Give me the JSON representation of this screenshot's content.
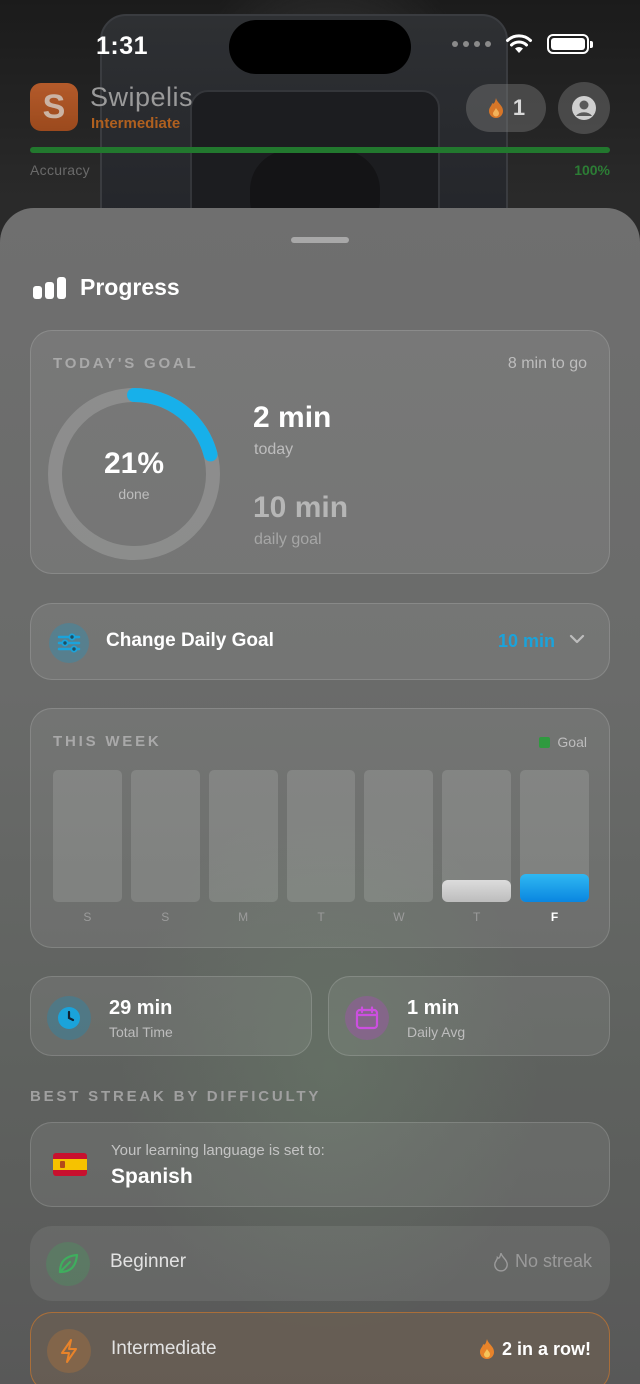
{
  "status_bar": {
    "time": "1:31"
  },
  "app": {
    "name": "Swipelis",
    "logo_letter": "S",
    "level": "Intermediate",
    "streak_count": "1",
    "accuracy_label": "Accuracy",
    "accuracy_value": "100%",
    "accuracy_fraction": 1.0
  },
  "sheet": {
    "title": "Progress",
    "today": {
      "caption": "TODAY'S GOAL",
      "to_go": "8 min to go",
      "percent_text": "21%",
      "percent_value": 0.21,
      "done_label": "done",
      "today_value": "2 min",
      "today_label": "today",
      "goal_value": "10 min",
      "goal_label": "daily goal"
    },
    "change_goal": {
      "label": "Change Daily Goal",
      "value": "10 min"
    },
    "week": {
      "caption": "THIS WEEK",
      "legend": "Goal",
      "days": [
        {
          "label": "S",
          "fraction": 0,
          "today": false
        },
        {
          "label": "S",
          "fraction": 0,
          "today": false
        },
        {
          "label": "M",
          "fraction": 0,
          "today": false
        },
        {
          "label": "T",
          "fraction": 0,
          "today": false
        },
        {
          "label": "W",
          "fraction": 0,
          "today": false
        },
        {
          "label": "T",
          "fraction": 0.17,
          "today": false
        },
        {
          "label": "F",
          "fraction": 0.21,
          "today": true
        }
      ]
    },
    "stats": {
      "total_value": "29 min",
      "total_label": "Total Time",
      "avg_value": "1 min",
      "avg_label": "Daily Avg"
    },
    "streaks": {
      "caption": "BEST STREAK BY DIFFICULTY",
      "language_prompt": "Your learning language is set to:",
      "language": "Spanish",
      "beginner_label": "Beginner",
      "beginner_status": "No streak",
      "intermediate_label": "Intermediate",
      "intermediate_status": "2 in a row!"
    }
  },
  "colors": {
    "accent_blue": "#1aa3db",
    "streak_orange": "#e8832a",
    "accuracy_green": "#22782e",
    "goal_green": "#2f9a3f"
  },
  "icons": {
    "progress": "bar-chart-icon",
    "streak": "flame-icon",
    "profile": "person-icon",
    "goal": "sliders-icon",
    "total": "clock-icon",
    "avg": "calendar-icon",
    "beginner": "leaf-icon",
    "intermediate": "bolt-icon"
  }
}
